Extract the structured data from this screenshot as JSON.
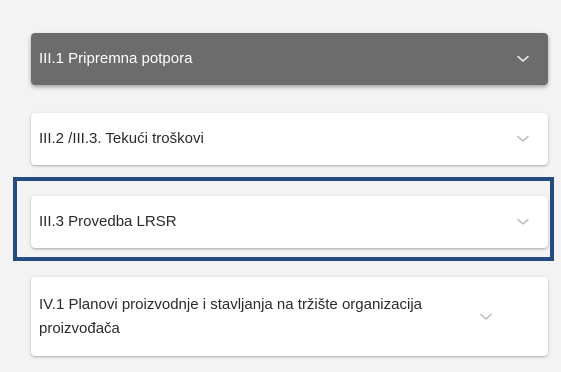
{
  "accordion": {
    "items": [
      {
        "label": "III.1 Pripremna potpora",
        "expanded_style": "dark"
      },
      {
        "label": "III.2 /III.3. Tekući troškovi"
      },
      {
        "label": "III.3 Provedba LRSR"
      },
      {
        "label": "IV.1 Planovi proizvodnje i stavljanja na tržište organizacija proizvođača"
      }
    ]
  },
  "colors": {
    "active_header": "#6c6c6c",
    "highlight": "#244b82",
    "background": "#f3f3f3"
  },
  "icons": {
    "expand": "chevron-down-icon"
  }
}
